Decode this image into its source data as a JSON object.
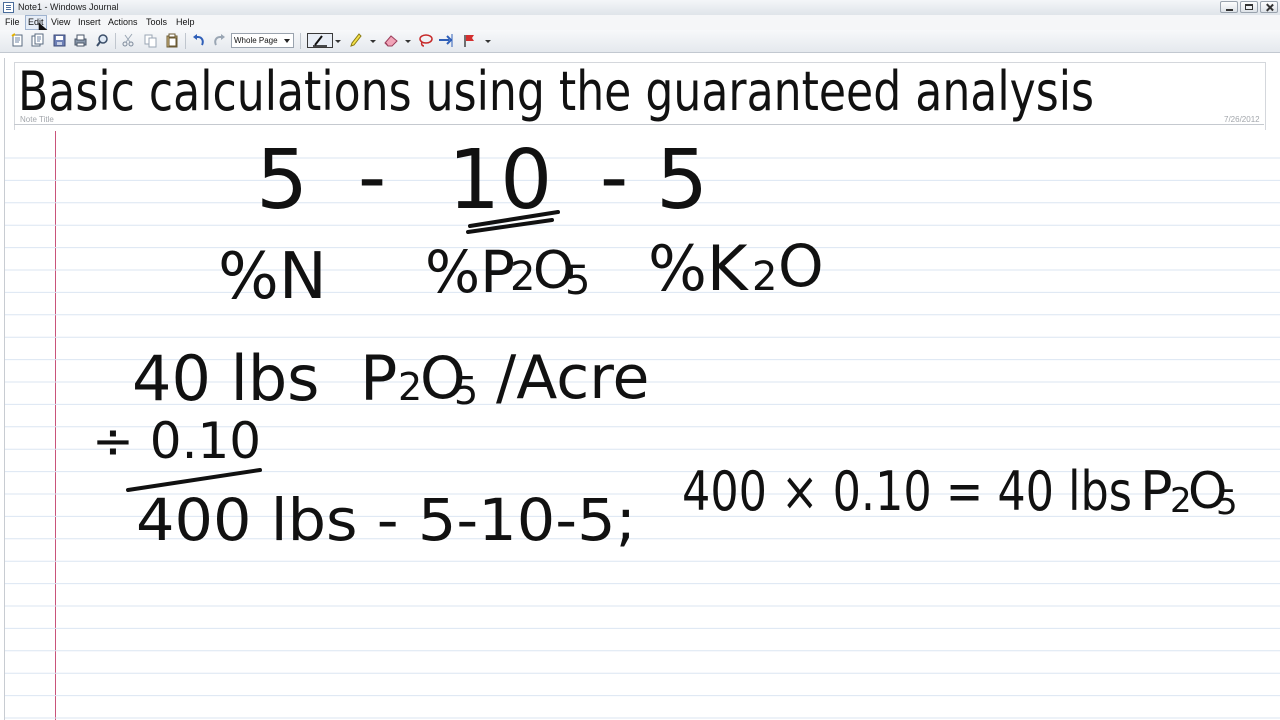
{
  "window": {
    "title": "Note1 - Windows Journal"
  },
  "menu": [
    {
      "id": "file",
      "label": "File"
    },
    {
      "id": "edit",
      "label": "Edit"
    },
    {
      "id": "view",
      "label": "View"
    },
    {
      "id": "insert",
      "label": "Insert"
    },
    {
      "id": "actions",
      "label": "Actions"
    },
    {
      "id": "tools",
      "label": "Tools"
    },
    {
      "id": "help",
      "label": "Help"
    }
  ],
  "toolbar": {
    "view_value": "Whole Page"
  },
  "note": {
    "title_label": "Note Title",
    "date": "7/26/2012",
    "heading": "Basic calculations using the guaranteed analysis",
    "grade": [
      "5",
      "-",
      "10",
      "-",
      "5"
    ],
    "nutrients": [
      "%N",
      "%P",
      "2",
      "O",
      "5",
      "%K",
      "2",
      "O"
    ],
    "rate_qty": "40 lbs",
    "rate_p": "P",
    "rate_sub": "2",
    "rate_o": "O",
    "rate_sub2": "5",
    "rate_unit": "/Acre",
    "divisor": "÷ 0.10",
    "result": "400 lbs - 5-10-5;",
    "check": "400 × 0.10 = 40 lbs",
    "check_p": "P",
    "check_sub": "2",
    "check_o": "O",
    "check_sub2": "5"
  },
  "colors": {
    "ink": "#111111",
    "rule": "#dbe6f2",
    "margin": "#c9547a"
  }
}
